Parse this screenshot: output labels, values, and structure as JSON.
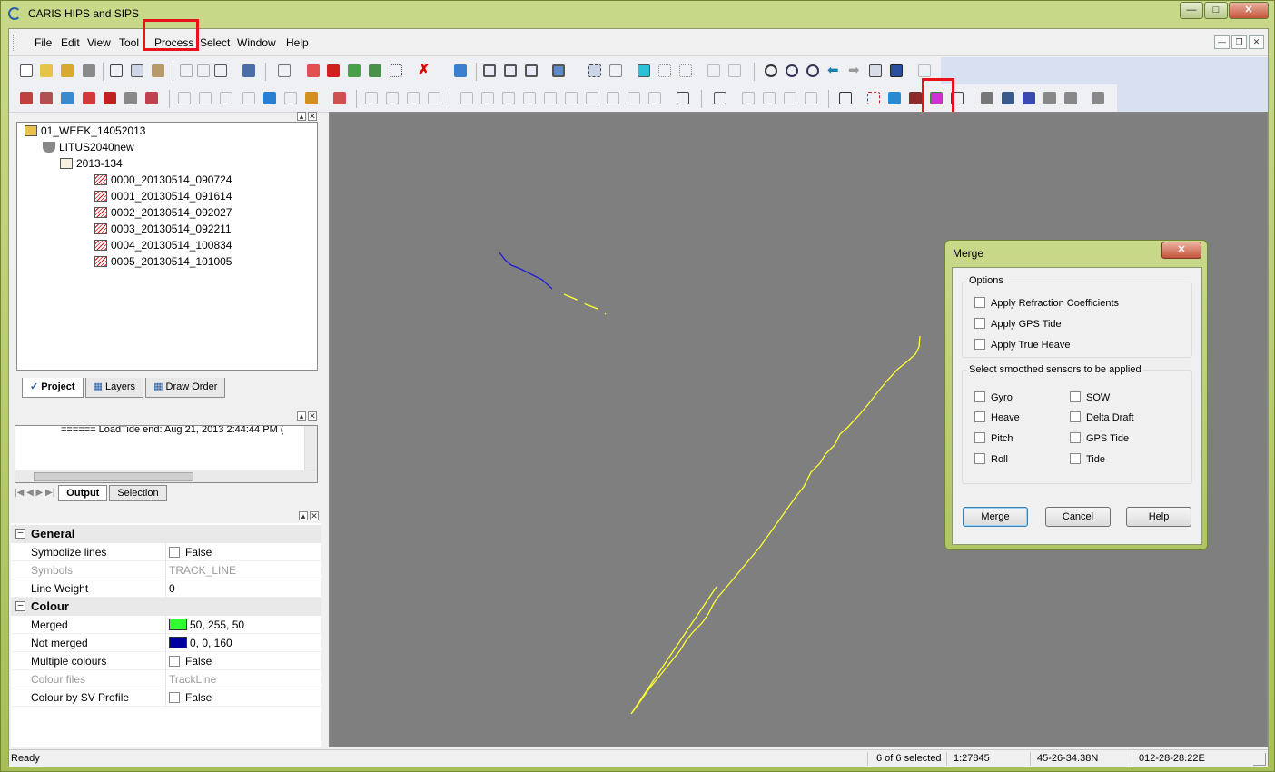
{
  "window": {
    "title": "CARIS HIPS and SIPS"
  },
  "menu": {
    "items": [
      "File",
      "Edit",
      "View",
      "Tools",
      "Process",
      "Select",
      "Window",
      "Help"
    ],
    "visible_labels": [
      "File",
      "Edit",
      "View",
      "Tool",
      "Process",
      "Select",
      "Window",
      "Help"
    ]
  },
  "project_tree": {
    "root": "01_WEEK_14052013",
    "vessel": "LITUS2040new",
    "day": "2013-134",
    "lines": [
      "0000_20130514_090724",
      "0001_20130514_091614",
      "0002_20130514_092027",
      "0003_20130514_092211",
      "0004_20130514_100834",
      "0005_20130514_101005"
    ],
    "tabs": [
      "Project",
      "Layers",
      "Draw Order"
    ]
  },
  "output": {
    "log_text": "====== LoadTide end: Aug 21, 2013 2:44:44 PM (",
    "tabs": [
      "Output",
      "Selection"
    ]
  },
  "properties": {
    "groups": [
      {
        "name": "General",
        "rows": [
          {
            "key": "Symbolize lines",
            "value": "False",
            "checkbox": true,
            "dim": false
          },
          {
            "key": "Symbols",
            "value": "TRACK_LINE",
            "checkbox": false,
            "dim": true
          },
          {
            "key": "Line Weight",
            "value": "0",
            "checkbox": false,
            "dim": false
          }
        ]
      },
      {
        "name": "Colour",
        "rows": [
          {
            "key": "Merged",
            "value": "50, 255, 50",
            "swatch": "#32ff32"
          },
          {
            "key": "Not merged",
            "value": "0, 0, 160",
            "swatch": "#0000a0"
          },
          {
            "key": "Multiple colours",
            "value": "False",
            "checkbox": true
          },
          {
            "key": "Colour files",
            "value": "TrackLine",
            "dim": true
          },
          {
            "key": "Colour by SV Profile",
            "value": "False",
            "checkbox": true
          }
        ]
      }
    ]
  },
  "status_bar": {
    "ready": "Ready",
    "selected": "6 of 6 selected",
    "scale": "1:27845",
    "latitude": "45-26-34.38N",
    "longitude": "012-28-28.22E"
  },
  "merge_dialog": {
    "title": "Merge",
    "options_label": "Options",
    "options": [
      "Apply Refraction Coefficients",
      "Apply GPS Tide",
      "Apply True Heave"
    ],
    "sensors_label": "Select smoothed sensors to be applied",
    "sensors_left": [
      "Gyro",
      "Heave",
      "Pitch",
      "Roll"
    ],
    "sensors_right": [
      "SOW",
      "Delta Draft",
      "GPS Tide",
      "Tide"
    ],
    "buttons": {
      "merge": "Merge",
      "cancel": "Cancel",
      "help": "Help"
    }
  },
  "colors": {
    "highlight": "#e8121a",
    "map_bg": "#7f7f7f",
    "track_merged": "#ffff33",
    "track_unmerged": "#1e1ed2"
  }
}
